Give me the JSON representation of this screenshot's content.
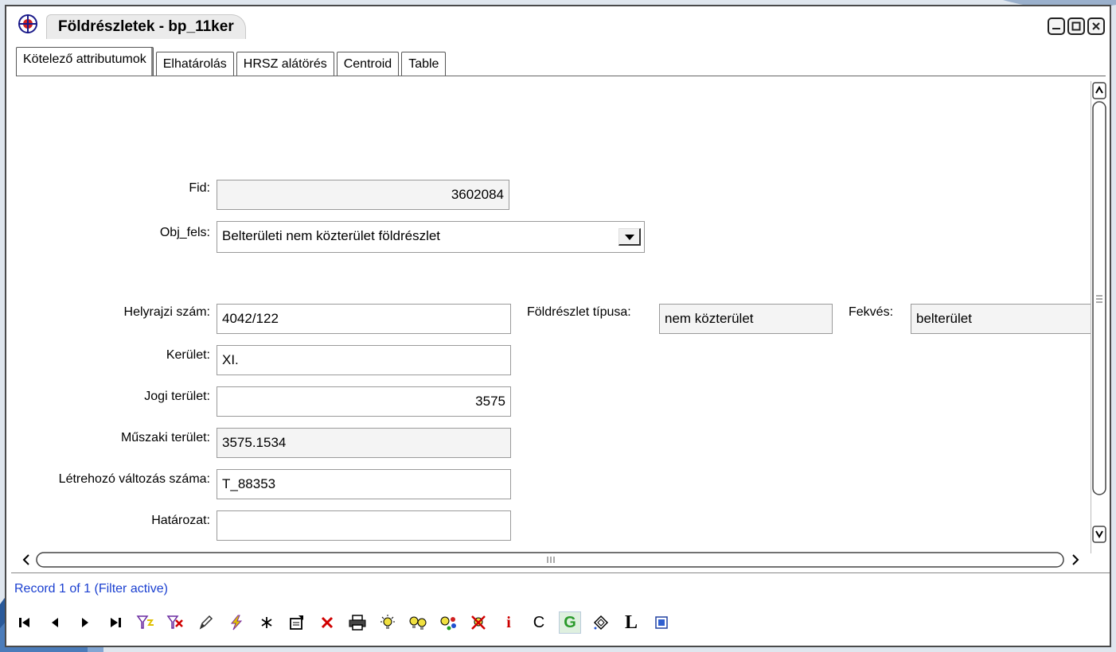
{
  "window": {
    "title": "Földrészletek - bp_11ker"
  },
  "tabs": [
    {
      "label": "Kötelező attributumok",
      "active": true
    },
    {
      "label": "Elhatárolás",
      "active": false
    },
    {
      "label": "HRSZ alátörés",
      "active": false
    },
    {
      "label": "Centroid",
      "active": false
    },
    {
      "label": "Table",
      "active": false
    }
  ],
  "form": {
    "fid": {
      "label": "Fid:",
      "value": "3602084"
    },
    "obj_fels": {
      "label": "Obj_fels:",
      "value": "Belterületi nem közterület földrészlet"
    },
    "helyrajzi_szam": {
      "label": "Helyrajzi szám:",
      "value": "4042/122"
    },
    "foldreszlet_tipusa": {
      "label": "Földrészlet típusa:",
      "value": "nem közterület"
    },
    "fekves": {
      "label": "Fekvés:",
      "value": "belterület"
    },
    "kerulet": {
      "label": "Kerület:",
      "value": "XI."
    },
    "jogi_terulet": {
      "label": "Jogi terület:",
      "value": "3575"
    },
    "muszaki_terulet": {
      "label": "Műszaki terület:",
      "value": "3575.1534"
    },
    "letrehozo_valtozas": {
      "label": "Létrehozó változás száma:",
      "value": "T_88353"
    },
    "hatarozat": {
      "label": "Határozat:",
      "value": ""
    }
  },
  "status": {
    "text": "Record 1 of 1 (Filter active)"
  },
  "toolbar": {
    "letter_i": "i",
    "letter_c": "C",
    "letter_g": "G",
    "letter_l": "L"
  },
  "colors": {
    "status_text": "#1a3fd0",
    "delete_red": "#d00000",
    "lightning_yellow": "#e0c000",
    "g_green": "#2a9a2a",
    "info_red": "#cc0000"
  }
}
